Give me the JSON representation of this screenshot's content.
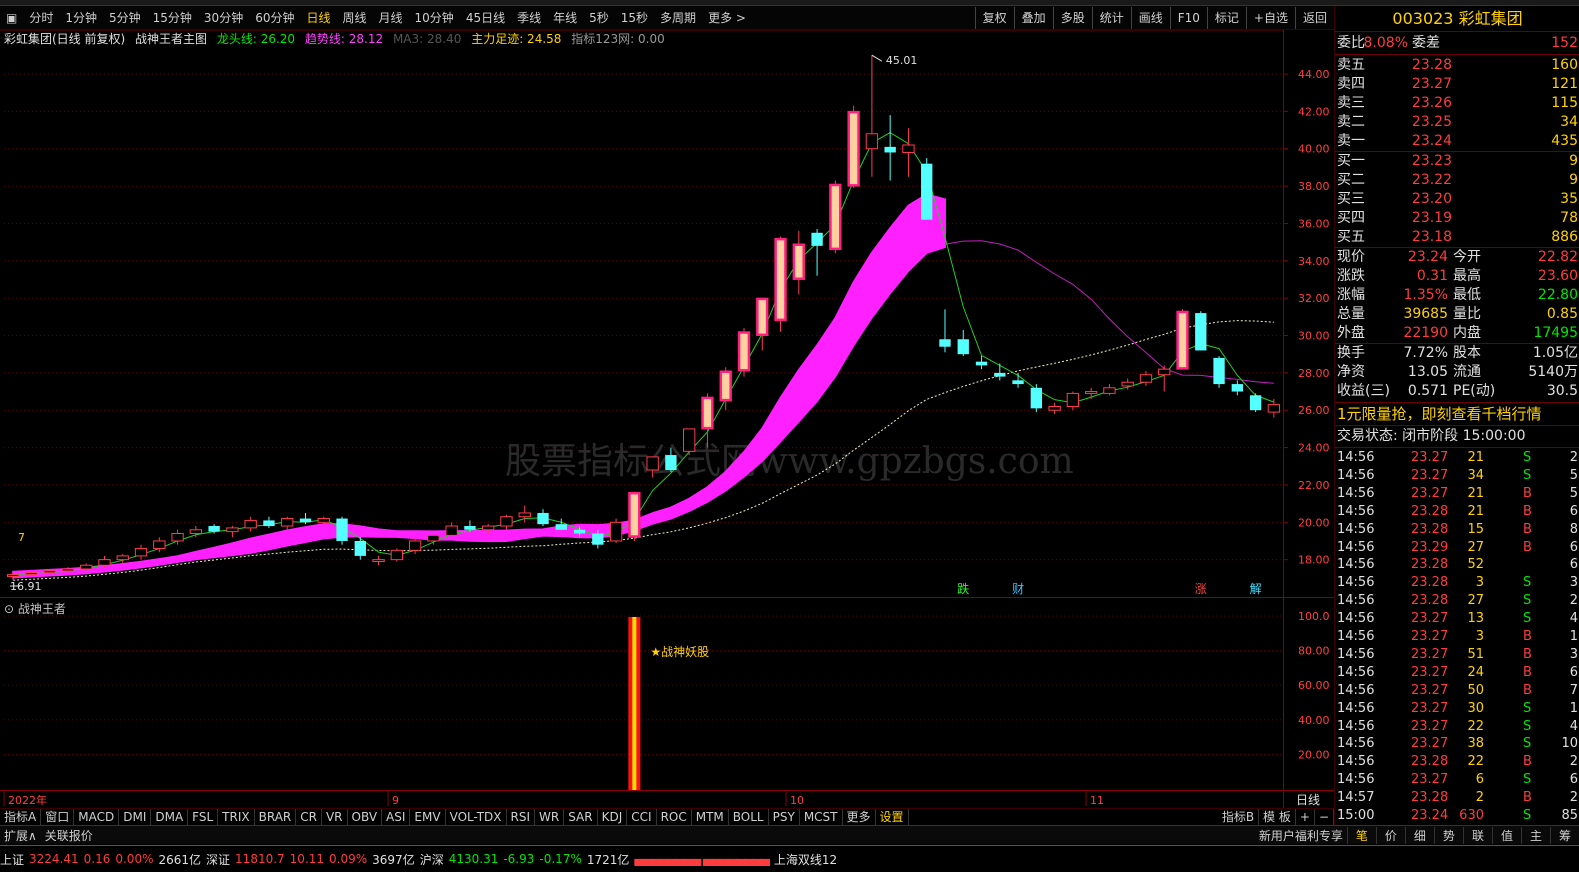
{
  "toolbar": {
    "periods": [
      "分时",
      "1分钟",
      "5分钟",
      "15分钟",
      "30分钟",
      "60分钟",
      "日线",
      "周线",
      "月线",
      "10分钟",
      "45日线",
      "季线",
      "年线",
      "5秒",
      "15秒",
      "多周期",
      "更多 >"
    ],
    "active_period": "日线",
    "tools": [
      "复权",
      "叠加",
      "多股",
      "统计",
      "画线",
      "F10",
      "标记",
      "+自选",
      "返回"
    ]
  },
  "chart_info": {
    "title": "彩虹集团(日线 前复权)",
    "main_indicator": "战神王者主图",
    "longtou_label": "龙头线: 26.20",
    "qushi_label": "趋势线: 28.12",
    "ma_label": "MA3: 28.40",
    "zhuli_label": "主力足迹: 24.58",
    "zhibiao_label": "指标123网: 0.00"
  },
  "price_axis": [
    "44.00",
    "42.00",
    "40.00",
    "38.00",
    "36.00",
    "34.00",
    "32.00",
    "30.00",
    "28.00",
    "26.00",
    "24.00",
    "22.00",
    "20.00",
    "18.00"
  ],
  "ind_axis": [
    "100.0",
    "80.00",
    "60.00",
    "40.00",
    "20.00"
  ],
  "annotations": {
    "high_label": "45.01",
    "low_label": "16.91",
    "left_marker": "7",
    "events": [
      "跌",
      "财",
      "涨",
      "解"
    ],
    "signal": "★战神妖股",
    "watermark": "股票指标公式网www.gpzbgs.com"
  },
  "indicator_name": "战神王者",
  "date_axis": [
    "2022年",
    "9",
    "10",
    "11"
  ],
  "date_corner": "日线",
  "tabs": [
    "指标A",
    "窗口",
    "MACD",
    "DMI",
    "DMA",
    "FSL",
    "TRIX",
    "BRAR",
    "CR",
    "VR",
    "OBV",
    "ASI",
    "EMV",
    "VOL-TDX",
    "RSI",
    "WR",
    "SAR",
    "KDJ",
    "CCI",
    "ROC",
    "MTM",
    "BOLL",
    "PSY",
    "MCST",
    "更多",
    "设置"
  ],
  "tabs_right": [
    "指标B",
    "模 板",
    "+",
    "−"
  ],
  "ext": {
    "left": [
      "扩展∧",
      "关联报价"
    ],
    "promo": "新用户福利专享",
    "right": [
      "笔",
      "价",
      "细",
      "势",
      "联",
      "值",
      "主",
      "筹"
    ]
  },
  "status": {
    "sh_label": "上证",
    "sh_val": "3224.41",
    "sh_chg": "0.16",
    "sh_pct": "0.00%",
    "sh_amt": "2661亿",
    "sz_label": "深证",
    "sz_val": "11810.7",
    "sz_chg": "10.11",
    "sz_pct": "0.09%",
    "sz_amt": "3697亿",
    "hs_label": "沪深",
    "hs_val": "4130.31",
    "hs_chg": "-6.93",
    "hs_pct": "-0.17%",
    "hs_amt": "1721亿",
    "ticker": "上海双线12"
  },
  "panel": {
    "code": "003023 彩虹集团",
    "weibi_label": "委比",
    "weibi_val": "8.08%",
    "weicha_label": "委差",
    "weicha_val": "152",
    "asks": [
      {
        "label": "卖五",
        "price": "23.28",
        "vol": "160"
      },
      {
        "label": "卖四",
        "price": "23.27",
        "vol": "121"
      },
      {
        "label": "卖三",
        "price": "23.26",
        "vol": "115"
      },
      {
        "label": "卖二",
        "price": "23.25",
        "vol": "34"
      },
      {
        "label": "卖一",
        "price": "23.24",
        "vol": "435"
      }
    ],
    "bids": [
      {
        "label": "买一",
        "price": "23.23",
        "vol": "9"
      },
      {
        "label": "买二",
        "price": "23.22",
        "vol": "9"
      },
      {
        "label": "买三",
        "price": "23.20",
        "vol": "35"
      },
      {
        "label": "买四",
        "price": "23.19",
        "vol": "78"
      },
      {
        "label": "买五",
        "price": "23.18",
        "vol": "886"
      }
    ],
    "quote": [
      {
        "l1": "现价",
        "v1": "23.24",
        "l2": "今开",
        "v2": "22.82"
      },
      {
        "l1": "涨跌",
        "v1": "0.31",
        "l2": "最高",
        "v2": "23.60"
      },
      {
        "l1": "涨幅",
        "v1": "1.35%",
        "l2": "最低",
        "v2": "22.80"
      },
      {
        "l1": "总量",
        "v1": "39685",
        "l2": "量比",
        "v2": "0.85"
      },
      {
        "l1": "外盘",
        "v1": "22190",
        "l2": "内盘",
        "v2": "17495"
      }
    ],
    "fund": [
      {
        "l1": "换手",
        "v1": "7.72%",
        "l2": "股本",
        "v2": "1.05亿"
      },
      {
        "l1": "净资",
        "v1": "13.05",
        "l2": "流通",
        "v2": "5140万"
      },
      {
        "l1": "收益(三)",
        "v1": "0.571",
        "l2": "PE(动)",
        "v2": "30.5"
      }
    ],
    "promo": "1元限量抢，即刻查看千档行情",
    "trade_state": "交易状态: 闭市阶段 15:00:00",
    "ticks": [
      {
        "t": "14:56",
        "p": "23.27",
        "v": "21",
        "bs": "S",
        "n": "2"
      },
      {
        "t": "14:56",
        "p": "23.27",
        "v": "34",
        "bs": "S",
        "n": "5"
      },
      {
        "t": "14:56",
        "p": "23.27",
        "v": "21",
        "bs": "B",
        "n": "5"
      },
      {
        "t": "14:56",
        "p": "23.28",
        "v": "21",
        "bs": "B",
        "n": "6"
      },
      {
        "t": "14:56",
        "p": "23.28",
        "v": "15",
        "bs": "B",
        "n": "8"
      },
      {
        "t": "14:56",
        "p": "23.29",
        "v": "27",
        "bs": "B",
        "n": "6"
      },
      {
        "t": "14:56",
        "p": "23.28",
        "v": "52",
        "bs": "",
        "n": "6"
      },
      {
        "t": "14:56",
        "p": "23.28",
        "v": "3",
        "bs": "S",
        "n": "3"
      },
      {
        "t": "14:56",
        "p": "23.28",
        "v": "27",
        "bs": "S",
        "n": "2"
      },
      {
        "t": "14:56",
        "p": "23.27",
        "v": "13",
        "bs": "S",
        "n": "4"
      },
      {
        "t": "14:56",
        "p": "23.27",
        "v": "3",
        "bs": "B",
        "n": "1"
      },
      {
        "t": "14:56",
        "p": "23.27",
        "v": "51",
        "bs": "B",
        "n": "3"
      },
      {
        "t": "14:56",
        "p": "23.27",
        "v": "24",
        "bs": "B",
        "n": "6"
      },
      {
        "t": "14:56",
        "p": "23.27",
        "v": "50",
        "bs": "B",
        "n": "7"
      },
      {
        "t": "14:56",
        "p": "23.27",
        "v": "30",
        "bs": "S",
        "n": "1"
      },
      {
        "t": "14:56",
        "p": "23.27",
        "v": "22",
        "bs": "S",
        "n": "4"
      },
      {
        "t": "14:56",
        "p": "23.27",
        "v": "38",
        "bs": "S",
        "n": "10"
      },
      {
        "t": "14:56",
        "p": "23.28",
        "v": "22",
        "bs": "B",
        "n": "2"
      },
      {
        "t": "14:56",
        "p": "23.27",
        "v": "6",
        "bs": "S",
        "n": "6"
      },
      {
        "t": "14:57",
        "p": "23.28",
        "v": "2",
        "bs": "B",
        "n": "2"
      },
      {
        "t": "15:00",
        "p": "23.24",
        "v": "630",
        "bs": "S",
        "n": "85"
      }
    ]
  },
  "chart_data": {
    "type": "candlestick",
    "price_range": [
      16,
      45.5
    ],
    "candles": [
      [
        17.1,
        17.3,
        16.91,
        17.2
      ],
      [
        17.2,
        17.4,
        17.1,
        17.3
      ],
      [
        17.3,
        17.4,
        17.2,
        17.4
      ],
      [
        17.4,
        17.6,
        17.3,
        17.5
      ],
      [
        17.5,
        17.8,
        17.4,
        17.7
      ],
      [
        17.7,
        18.2,
        17.6,
        18.0
      ],
      [
        18.0,
        18.3,
        17.8,
        18.2
      ],
      [
        18.2,
        18.8,
        18.0,
        18.6
      ],
      [
        18.6,
        19.2,
        18.4,
        19.0
      ],
      [
        19.0,
        19.6,
        18.8,
        19.4
      ],
      [
        19.4,
        19.8,
        19.2,
        19.6
      ],
      [
        19.8,
        19.9,
        19.4,
        19.5
      ],
      [
        19.5,
        19.8,
        19.2,
        19.7
      ],
      [
        19.7,
        20.3,
        19.5,
        20.1
      ],
      [
        20.1,
        20.3,
        19.7,
        19.8
      ],
      [
        19.8,
        20.3,
        19.6,
        20.2
      ],
      [
        20.2,
        20.5,
        19.9,
        20.0
      ],
      [
        20.0,
        20.3,
        19.8,
        20.2
      ],
      [
        20.2,
        20.3,
        18.8,
        19.0
      ],
      [
        19.0,
        19.2,
        18.0,
        18.2
      ],
      [
        17.9,
        18.2,
        17.7,
        18.0
      ],
      [
        18.0,
        18.6,
        17.9,
        18.5
      ],
      [
        18.5,
        19.2,
        18.3,
        19.0
      ],
      [
        19.0,
        19.4,
        18.8,
        19.3
      ],
      [
        19.3,
        20.0,
        19.1,
        19.8
      ],
      [
        19.8,
        20.1,
        19.5,
        19.6
      ],
      [
        19.6,
        19.9,
        19.4,
        19.8
      ],
      [
        19.8,
        20.4,
        19.6,
        20.3
      ],
      [
        20.3,
        20.9,
        20.0,
        20.5
      ],
      [
        20.5,
        20.7,
        19.8,
        19.9
      ],
      [
        19.9,
        20.2,
        19.6,
        19.6
      ],
      [
        19.6,
        19.8,
        19.2,
        19.4
      ],
      [
        19.4,
        19.6,
        18.6,
        18.8
      ],
      [
        19.0,
        20.2,
        18.9,
        20.0
      ],
      [
        19.2,
        21.6,
        19.0,
        21.6
      ],
      [
        22.8,
        23.5,
        22.4,
        23.5
      ],
      [
        23.6,
        24.0,
        22.7,
        22.8
      ],
      [
        23.8,
        25.0,
        23.6,
        25.0
      ],
      [
        25.0,
        26.9,
        24.0,
        26.7
      ],
      [
        26.5,
        28.3,
        26.0,
        28.1
      ],
      [
        28.1,
        30.4,
        27.8,
        30.2
      ],
      [
        30.0,
        32.0,
        29.2,
        32.0
      ],
      [
        30.8,
        35.3,
        30.2,
        35.2
      ],
      [
        33.0,
        35.6,
        32.2,
        34.9
      ],
      [
        35.5,
        35.7,
        33.2,
        34.8
      ],
      [
        34.6,
        38.3,
        34.4,
        38.1
      ],
      [
        38.0,
        42.3,
        37.9,
        42.0
      ],
      [
        40.0,
        45.01,
        38.5,
        40.8
      ],
      [
        40.1,
        41.8,
        38.3,
        39.8
      ],
      [
        39.8,
        41.1,
        38.5,
        40.2
      ],
      [
        39.2,
        39.5,
        36.2,
        36.2
      ],
      [
        29.8,
        31.4,
        29.1,
        29.4
      ],
      [
        29.8,
        30.3,
        28.9,
        29.0
      ],
      [
        28.6,
        28.9,
        28.2,
        28.4
      ],
      [
        28.0,
        28.5,
        27.6,
        27.8
      ],
      [
        27.6,
        28.0,
        27.2,
        27.4
      ],
      [
        27.2,
        27.4,
        25.9,
        26.1
      ],
      [
        26.0,
        26.4,
        25.8,
        26.2
      ],
      [
        26.2,
        27.0,
        26.0,
        26.9
      ],
      [
        26.9,
        27.2,
        26.6,
        27.0
      ],
      [
        26.9,
        27.4,
        26.8,
        27.2
      ],
      [
        27.3,
        27.7,
        27.1,
        27.5
      ],
      [
        27.5,
        28.1,
        27.3,
        27.9
      ],
      [
        27.9,
        28.4,
        27.0,
        28.2
      ],
      [
        28.2,
        31.4,
        28.2,
        31.3
      ],
      [
        31.2,
        31.3,
        29.2,
        29.2
      ],
      [
        28.8,
        28.9,
        27.2,
        27.4
      ],
      [
        27.4,
        27.6,
        26.8,
        27.0
      ],
      [
        26.8,
        26.9,
        25.9,
        26.0
      ],
      [
        25.9,
        26.6,
        25.6,
        26.3
      ]
    ],
    "signal_bar": {
      "index": 34,
      "range": [
        0,
        100
      ]
    }
  }
}
